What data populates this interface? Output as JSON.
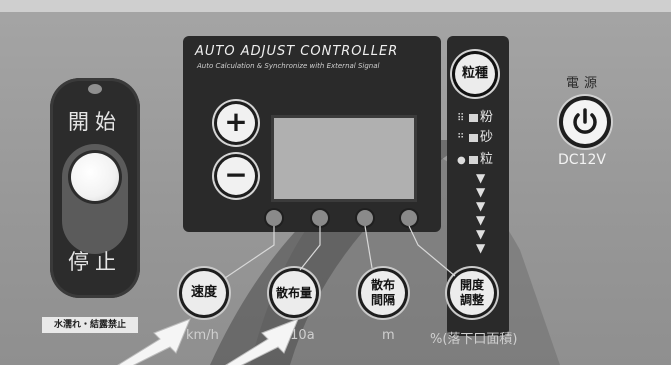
{
  "controller": {
    "title": "AUTO ADJUST CONTROLLER",
    "subtitle": "Auto Calculation & Synchronize with External Signal"
  },
  "start_stop": {
    "start_label": "開始",
    "stop_label": "停止",
    "warning_label": "水濡れ・結露禁止"
  },
  "adjust": {
    "plus_label": "+",
    "minus_label": "−"
  },
  "grain": {
    "button_label": "粒種",
    "options": [
      {
        "marker": "⠿",
        "label": "粉"
      },
      {
        "marker": "⠛",
        "label": "砂"
      },
      {
        "marker": "●",
        "label": "粒"
      }
    ]
  },
  "power": {
    "label": "電源",
    "voltage": "DC12V"
  },
  "bottom_buttons": [
    {
      "label": "速度",
      "unit": "km/h"
    },
    {
      "label": "散布量",
      "unit": "kg/10a"
    },
    {
      "label_line1": "散布",
      "label_line2": "間隔",
      "unit": "m"
    },
    {
      "label_line1": "開度",
      "label_line2": "調整",
      "unit": "%(落下口面積)"
    }
  ],
  "colors": {
    "panel": "#9a9a9a",
    "dark": "#2a2a2a",
    "button": "#ececec"
  }
}
